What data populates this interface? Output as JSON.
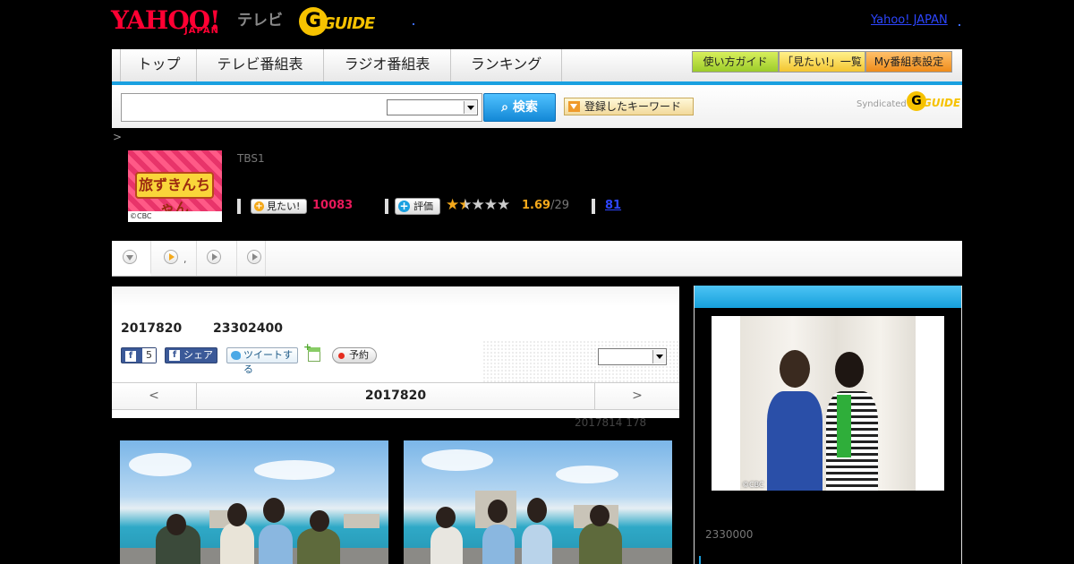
{
  "header": {
    "yahoo_logo_main": "YAHOO!",
    "yahoo_logo_sub": "JAPAN",
    "tv_label": "テレビ",
    "gguide_logo": "GUIDE",
    "yahoo_japan_link": "Yahoo! JAPAN"
  },
  "nav": {
    "tabs": [
      "トップ",
      "テレビ番組表",
      "ラジオ番組表",
      "ランキング"
    ],
    "buttons": [
      "使い方ガイド",
      "「見たい!」一覧",
      "My番組表設定"
    ]
  },
  "search": {
    "input_value": "",
    "select_value": "",
    "button_label": "検索",
    "keyword_button": "登録したキーワード",
    "syndicated_label": "Syndicated",
    "syndicated_logo": "GUIDE"
  },
  "breadcrumb": ">",
  "program": {
    "thumbnail_title": "旅ずきんちゃん",
    "thumbnail_credit": "©CBC",
    "channel": "TBS1",
    "mitai_label": "見たい!",
    "mitai_count": "10083",
    "hyoka_label": "評価",
    "rating_value": 1.69,
    "rating_display": "1.69",
    "rating_denominator": "/29",
    "review_count": "81"
  },
  "subtabs": {
    "second_tab_text": ","
  },
  "broadcast": {
    "date": "2017820",
    "time": "23302400",
    "fb_like_count": "5",
    "fb_share_label": "シェア",
    "tweet_label": "ツイートする",
    "reserve_label": "予約",
    "select_value": "",
    "nav_prev": "<",
    "nav_date": "2017820",
    "nav_next": ">"
  },
  "update_note": "2017814  178",
  "side": {
    "image_credit": "©CBC",
    "caption": "2330000"
  },
  "colors": {
    "accent_blue": "#1aa0e0",
    "mitai_pink": "#e8195a",
    "rating_orange": "#f4a91b",
    "link_blue": "#2d46ff"
  }
}
